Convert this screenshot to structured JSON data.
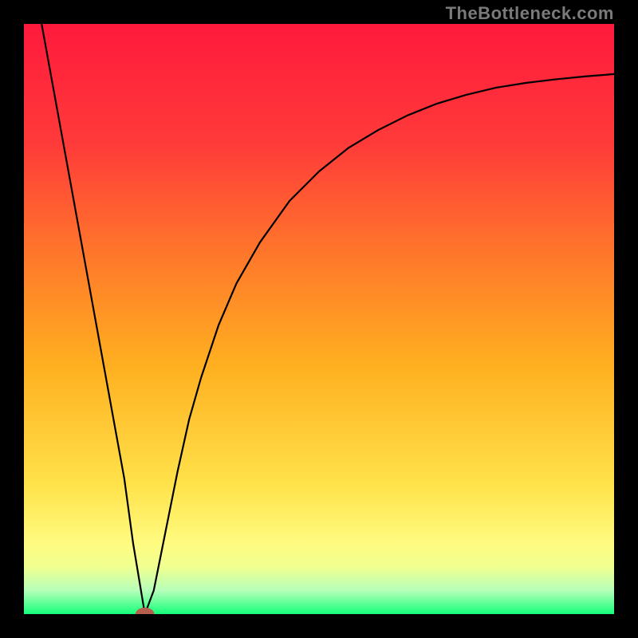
{
  "watermark": "TheBottleneck.com",
  "chart_data": {
    "type": "line",
    "title": "",
    "xlabel": "",
    "ylabel": "",
    "xlim": [
      0,
      100
    ],
    "ylim": [
      0,
      100
    ],
    "background_gradient_stops": [
      {
        "offset": 0.0,
        "color": "#ff1a3c"
      },
      {
        "offset": 0.2,
        "color": "#ff3a3a"
      },
      {
        "offset": 0.4,
        "color": "#ff7a2a"
      },
      {
        "offset": 0.58,
        "color": "#ffb020"
      },
      {
        "offset": 0.78,
        "color": "#ffe24a"
      },
      {
        "offset": 0.88,
        "color": "#fffb80"
      },
      {
        "offset": 0.92,
        "color": "#f0ff90"
      },
      {
        "offset": 0.96,
        "color": "#b6ffba"
      },
      {
        "offset": 1.0,
        "color": "#15ff7a"
      }
    ],
    "series": [
      {
        "name": "curve",
        "x": [
          3,
          5,
          7,
          9,
          11,
          13,
          15,
          17,
          18.5,
          20,
          20.5,
          22,
          24,
          26,
          28,
          30,
          33,
          36,
          40,
          45,
          50,
          55,
          60,
          65,
          70,
          75,
          80,
          85,
          90,
          95,
          100
        ],
        "y": [
          100,
          89,
          78,
          67,
          56,
          45,
          34,
          23,
          12,
          3,
          0,
          4,
          14,
          24,
          33,
          40,
          49,
          56,
          63,
          70,
          75,
          79,
          82,
          84.5,
          86.5,
          88,
          89.2,
          90,
          90.6,
          91.1,
          91.5
        ]
      }
    ],
    "minimum_marker": {
      "x": 20.5,
      "y": 0,
      "rx": 1.6,
      "ry": 1.1,
      "fill": "#b5604e"
    }
  }
}
